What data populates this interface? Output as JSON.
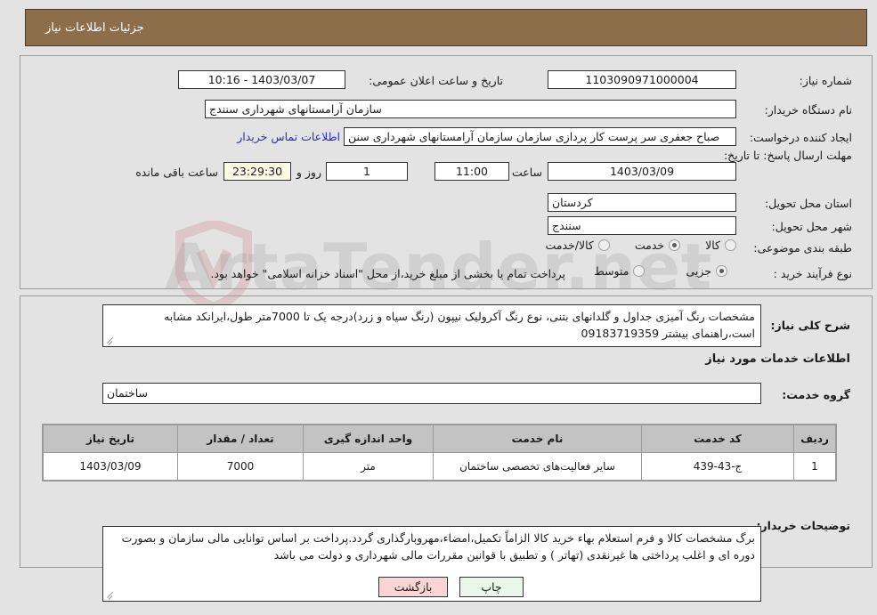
{
  "header": {
    "title": "جزئیات اطلاعات نیاز",
    "bar_color": "#8c6f4a"
  },
  "watermark": {
    "text": "ArtaTender.net"
  },
  "need_info": {
    "need_number_label": "شماره نیاز:",
    "need_number_value": "1103090971000004",
    "announce_datetime_label": "تاریخ و ساعت اعلان عمومی:",
    "announce_datetime_value": "1403/03/07 - 10:16",
    "buyer_org_label": "نام دستگاه خریدار:",
    "buyer_org_value": "سازمان آرامستانهای شهرداری سنندج",
    "creator_label": "ایجاد کننده درخواست:",
    "creator_value": "صباح جعفری سر پرست کار پردازی سازمان  سازمان آرامستانهای شهرداری سنن",
    "buyer_contact_link": "اطلاعات تماس خریدار",
    "deadline_label": "مهلت ارسال پاسخ: تا تاریخ:",
    "deadline_date_value": "1403/03/09",
    "deadline_time_label": "ساعت",
    "deadline_time_value": "11:00",
    "days_value": "1",
    "days_label": "روز و",
    "remaining_value": "23:29:30",
    "remaining_label": "ساعت باقی مانده",
    "province_label": "استان محل تحویل:",
    "province_value": "کردستان",
    "city_label": "شهر محل تحویل:",
    "city_value": "سنندج",
    "classification_label": "طبقه بندی موضوعی:",
    "classification_options": [
      {
        "label": "کالا",
        "selected": false
      },
      {
        "label": "خدمت",
        "selected": true
      },
      {
        "label": "کالا/خدمت",
        "selected": false
      }
    ],
    "purchase_type_label": "نوع فرآیند خرید :",
    "purchase_type_options": [
      {
        "label": "جزیی",
        "selected": true
      },
      {
        "label": "متوسط",
        "selected": false
      }
    ],
    "treasury_note": "پرداخت تمام یا بخشی از مبلغ خرید،از محل \"اسناد خزانه اسلامی\" خواهد بود."
  },
  "description": {
    "label": "شرح کلی نیاز:",
    "value": "مشخصات رنگ آمیزی جداول و گلدانهای بتنی، نوع رنگ آکرولیک نیپون (رنگ سیاه و زرد)درجه یک تا 7000متر طول،ایرانکد مشابه است،راهنمای بیشتر 09183719359"
  },
  "services": {
    "section_heading": "اطلاعات خدمات مورد نیاز",
    "group_label": "گروه خدمت:",
    "group_value": "ساختمان",
    "table": {
      "columns": [
        "ردیف",
        "کد خدمت",
        "نام خدمت",
        "واحد اندازه گیری",
        "تعداد / مقدار",
        "تاریخ نیاز"
      ],
      "rows": [
        {
          "row": "1",
          "code": "ج-43-439",
          "name": "سایر فعالیت‌های تخصصی ساختمان",
          "unit": "متر",
          "quantity": "7000",
          "need_date": "1403/03/09"
        }
      ]
    }
  },
  "buyer_notes": {
    "label": "توضیحات خریدار:",
    "value": "برگ مشخصات کالا و فرم استعلام بهاء خرید کالا الزاماً تکمیل،امضاء،مهروبارگذاری گردد.پرداخت بر اساس توانایی مالی سازمان  و بصورت دوره ای و اغلب پرداختی ها  غیرنقدی (تهاتر ) و تطبیق با قوانین مقررات مالی شهرداری و دولت می باشد"
  },
  "footer": {
    "print_label": "چاپ",
    "back_label": "بازگشت"
  }
}
